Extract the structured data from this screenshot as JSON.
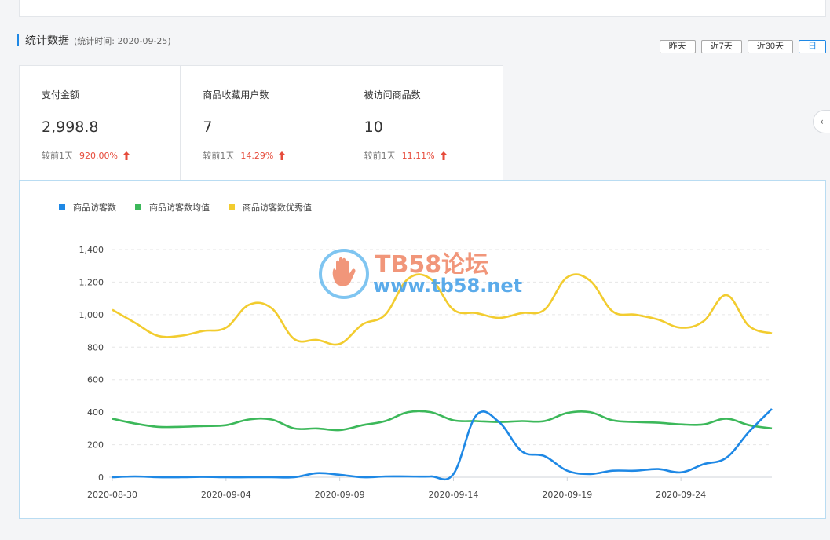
{
  "section": {
    "title": "统计数据",
    "time_text": "(统计时间: 2020-09-25)"
  },
  "range_buttons": [
    {
      "label": "昨天",
      "active": false
    },
    {
      "label": "近7天",
      "active": false
    },
    {
      "label": "近30天",
      "active": false
    },
    {
      "label": "日",
      "active": true
    }
  ],
  "cards": [
    {
      "label": "支付金额",
      "value": "2,998.8",
      "compare_label": "较前1天",
      "delta": "920.00%",
      "direction": "up"
    },
    {
      "label": "商品收藏用户数",
      "value": "7",
      "compare_label": "较前1天",
      "delta": "14.29%",
      "direction": "up"
    },
    {
      "label": "被访问商品数",
      "value": "10",
      "compare_label": "较前1天",
      "delta": "11.11%",
      "direction": "up"
    }
  ],
  "watermark": {
    "title": "TB58论坛",
    "url": "www.tb58.net"
  },
  "colors": {
    "accent": "#1e88e5",
    "up": "#e64b3b",
    "series_blue": "#1e88e5",
    "series_green": "#3cb85a",
    "series_yellow": "#f2cc2f"
  },
  "chart_data": {
    "type": "line",
    "x": [
      "2020-08-30",
      "2020-08-31",
      "2020-09-01",
      "2020-09-02",
      "2020-09-03",
      "2020-09-04",
      "2020-09-05",
      "2020-09-06",
      "2020-09-07",
      "2020-09-08",
      "2020-09-09",
      "2020-09-10",
      "2020-09-11",
      "2020-09-12",
      "2020-09-13",
      "2020-09-14",
      "2020-09-15",
      "2020-09-16",
      "2020-09-17",
      "2020-09-18",
      "2020-09-19",
      "2020-09-20",
      "2020-09-21",
      "2020-09-22",
      "2020-09-23",
      "2020-09-24",
      "2020-09-25",
      "2020-09-26",
      "2020-09-27",
      "2020-09-28"
    ],
    "x_tick_labels": [
      "2020-08-30",
      "2020-09-04",
      "2020-09-09",
      "2020-09-14",
      "2020-09-19",
      "2020-09-24"
    ],
    "y_tick_labels": [
      "0",
      "200",
      "400",
      "600",
      "800",
      "1,000",
      "1,200",
      "1,400"
    ],
    "ylim": [
      0,
      1400
    ],
    "grid": true,
    "legend_position": "top-left",
    "series": [
      {
        "name": "商品访客数",
        "color": "#1e88e5",
        "values": [
          0,
          5,
          0,
          0,
          2,
          0,
          0,
          0,
          0,
          25,
          15,
          0,
          5,
          5,
          5,
          20,
          380,
          340,
          160,
          130,
          40,
          20,
          40,
          40,
          50,
          30,
          80,
          120,
          280,
          420
        ]
      },
      {
        "name": "商品访客数均值",
        "color": "#3cb85a",
        "values": [
          360,
          330,
          310,
          310,
          315,
          320,
          355,
          355,
          300,
          300,
          290,
          320,
          345,
          400,
          400,
          350,
          345,
          340,
          345,
          345,
          395,
          400,
          350,
          340,
          335,
          325,
          325,
          360,
          320,
          300
        ]
      },
      {
        "name": "商品访客数优秀值",
        "color": "#f2cc2f",
        "values": [
          1030,
          950,
          870,
          870,
          900,
          920,
          1060,
          1040,
          850,
          845,
          820,
          940,
          1000,
          1220,
          1220,
          1030,
          1010,
          980,
          1010,
          1030,
          1230,
          1210,
          1020,
          1000,
          970,
          920,
          960,
          1120,
          930,
          885
        ]
      }
    ]
  }
}
